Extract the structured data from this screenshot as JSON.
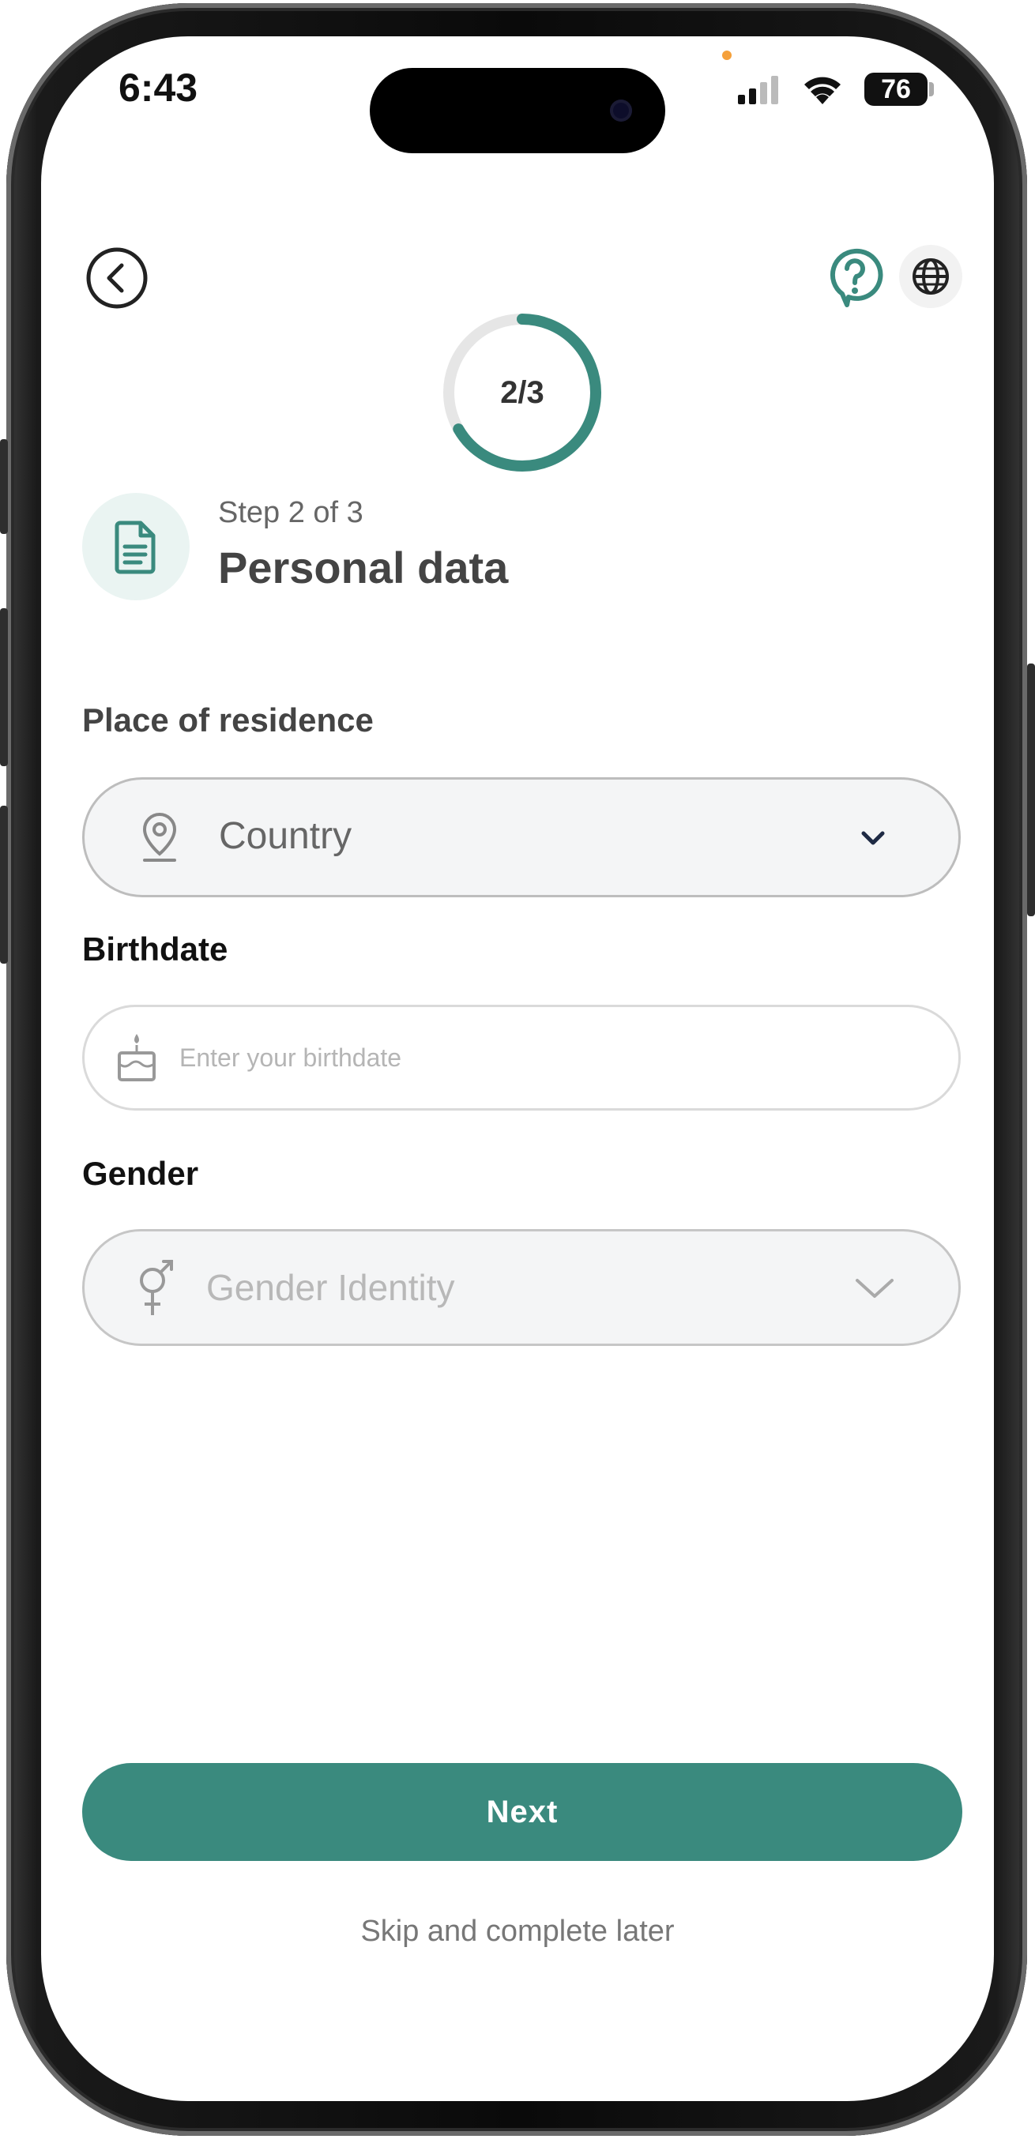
{
  "status_bar": {
    "time": "6:43",
    "battery": "76"
  },
  "header": {
    "progress_label": "2/3",
    "progress_fraction": 0.667
  },
  "step": {
    "subtitle": "Step 2 of 3",
    "title": "Personal data"
  },
  "form": {
    "residence": {
      "label": "Place of residence",
      "placeholder": "Country"
    },
    "birthdate": {
      "label": "Birthdate",
      "placeholder": "Enter your birthdate"
    },
    "gender": {
      "label": "Gender",
      "placeholder": "Gender Identity"
    }
  },
  "actions": {
    "next_label": "Next",
    "skip_label": "Skip and complete later"
  },
  "colors": {
    "accent": "#3a8a7e",
    "accent_light": "#eaf4f2",
    "text_dark": "#111111"
  }
}
